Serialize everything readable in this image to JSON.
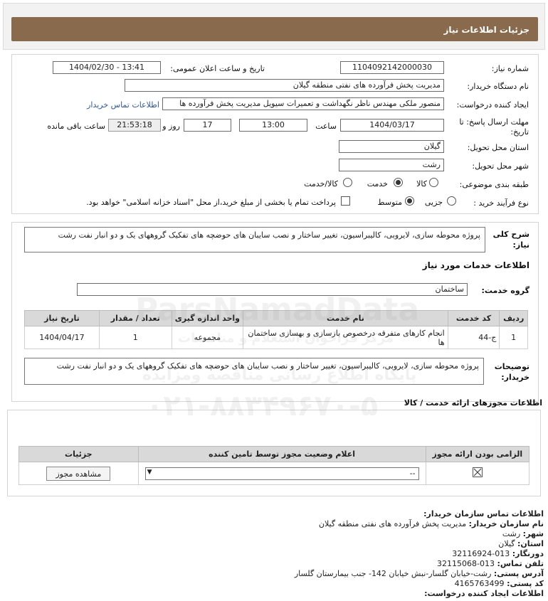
{
  "header": {
    "title": "جزئیات اطلاعات نیاز"
  },
  "form": {
    "need_number_label": "شماره نیاز:",
    "need_number": "1104092142000030",
    "announce_label": "تاریخ و ساعت اعلان عمومی:",
    "announce_value": "1404/02/30 - 13:41",
    "buyer_label": "نام دستگاه خریدار:",
    "buyer_value": "مدیریت پخش فرآورده های نفتی منطقه گیلان",
    "requester_label": "ایجاد کننده درخواست:",
    "requester_value": "منصور ملکی مهندس ناظر نگهداشت و تعمیرات سیویل مدیریت پخش فرآورده ها",
    "contact_link": "اطلاعات تماس خریدار",
    "deadline_label_1": "مهلت ارسال پاسخ: تا",
    "deadline_label_2": "تاریخ:",
    "deadline_date": "1404/03/17",
    "time_label": "ساعت",
    "deadline_time": "13:00",
    "days_value": "17",
    "days_label": "روز و",
    "remaining_time": "21:53:18",
    "remaining_label": "ساعت باقی مانده",
    "province_label": "استان محل تحویل:",
    "province_value": "گیلان",
    "city_label": "شهر محل تحویل:",
    "city_value": "رشت",
    "category_label": "طبقه بندی موضوعی:",
    "category_options": [
      "کالا",
      "خدمت",
      "کالا/خدمت"
    ],
    "category_selected": "خدمت",
    "process_label": "نوع فرآیند خرید :",
    "process_options": [
      "جزیی",
      "متوسط"
    ],
    "process_selected": "متوسط",
    "treasury_note": "پرداخت تمام یا بخشی از مبلغ خرید،از محل \"اسناد خزانه اسلامی\" خواهد بود."
  },
  "summary": {
    "label_1": "شرح کلی",
    "label_2": "نیاز:",
    "text": "پروژه محوطه سازی، لایروبی، کالیبراسیون، تغییر ساختار و نصب سایبان های حوضچه های تفکیک گروههای یک و دو انبار نفت رشت"
  },
  "services": {
    "title": "اطلاعات خدمات مورد نیاز",
    "group_label": "گروه خدمت:",
    "group_value": "ساختمان",
    "columns": [
      "ردیف",
      "کد خدمت",
      "نام خدمت",
      "واحد اندازه گیری",
      "تعداد / مقدار",
      "تاریخ نیاز"
    ],
    "rows": [
      {
        "row": "1",
        "code": "ج-44",
        "name": "انجام کارهای متفرقه درخصوص بازسازی و بهسازی ساختمان ها",
        "unit": "مجموعه",
        "qty": "1",
        "date": "1404/04/17"
      }
    ],
    "buyer_desc_label_1": "توضیحات",
    "buyer_desc_label_2": "خریدار:",
    "buyer_desc": "پروژه محوطه سازی، لایروبی، کالیبراسیون، تغییر ساختار و نصب سایبان های حوضچه های تفکیک گروههای یک و دو انبار نفت رشت"
  },
  "permits": {
    "title": "اطلاعات مجوزهای ارائه خدمت / کالا",
    "columns": [
      "الزامی بودن ارائه مجوز",
      "اعلام وضعیت مجوز توسط تامین کننده",
      "جزئیات"
    ],
    "status_value": "--",
    "view_button": "مشاهده مجوز"
  },
  "contact": {
    "title": "اطلاعات تماس سازمان خریدار:",
    "org_label": "نام سازمان خریدار:",
    "org_value": "مدیریت پخش فرآورده های نفتی منطقه گیلان",
    "city_label": "شهر:",
    "city_value": "رشت",
    "province_label": "استان:",
    "province_value": "گیلان",
    "fax_label": "دورنگار:",
    "fax_value": "013-32116924",
    "phone_label": "تلفن تماس:",
    "phone_value": "013-32115068",
    "address_label": "آدرس پستی:",
    "address_value": "رشت-خیابان گلسار-نبش خیابان 142- جنب بیمارستان گلسار",
    "postal_label": "کد پستی:",
    "postal_value": "4165763499",
    "creator_title": "اطلاعات ایجاد کننده درخواست:"
  },
  "watermark": {
    "brand": "ParsNamadData",
    "line1": "مرکز فراخوان استعلام و مناقصات",
    "line2": "پایگاه اطلاع رسانی مناقصه ومزایده",
    "phone": "۰۲۱-۸۸۳۴۹۶۷۰-۵"
  }
}
